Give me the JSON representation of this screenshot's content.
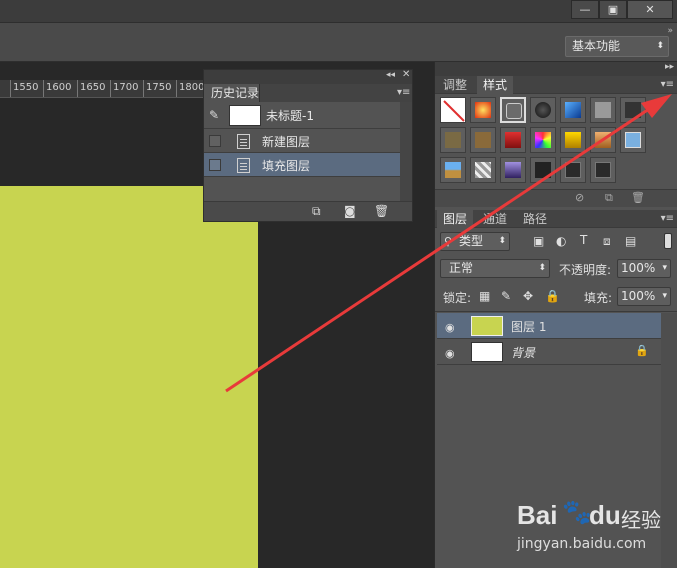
{
  "window": {
    "minimize_label": "—",
    "restore_label": "▣",
    "close_label": "✕"
  },
  "options_bar": {
    "workspace": "基本功能"
  },
  "ruler": {
    "ticks": [
      "1550",
      "1600",
      "1650",
      "1700",
      "1750",
      "1800"
    ]
  },
  "document": {
    "fill_color": "#c8d450"
  },
  "history_panel": {
    "tab": "历史记录",
    "snapshot_label": "未标题-1",
    "items": [
      {
        "label": "新建图层",
        "selected": false
      },
      {
        "label": "填充图层",
        "selected": true
      }
    ]
  },
  "styles_panel": {
    "tabs": [
      "调整",
      "样式"
    ],
    "active_tab": "样式"
  },
  "layers_panel": {
    "tabs": [
      "图层",
      "通道",
      "路径"
    ],
    "active_tab": "图层",
    "filter_label": "类型",
    "blend_mode": "正常",
    "opacity_label": "不透明度:",
    "opacity_value": "100%",
    "lock_label": "锁定:",
    "fill_label": "填充:",
    "fill_value": "100%",
    "layers": [
      {
        "name": "图层 1",
        "selected": true,
        "thumb_color": "#c8d450"
      },
      {
        "name": "背景",
        "selected": false,
        "thumb_color": "#ffffff"
      }
    ]
  },
  "watermark": {
    "brand": "Bai",
    "brand_suffix": "du",
    "cn": "经验",
    "url": "jingyan.baidu.com"
  },
  "colors": {
    "accent_selection": "#5b6b80",
    "arrow": "#e83a3a",
    "panel_bg": "#535353"
  }
}
